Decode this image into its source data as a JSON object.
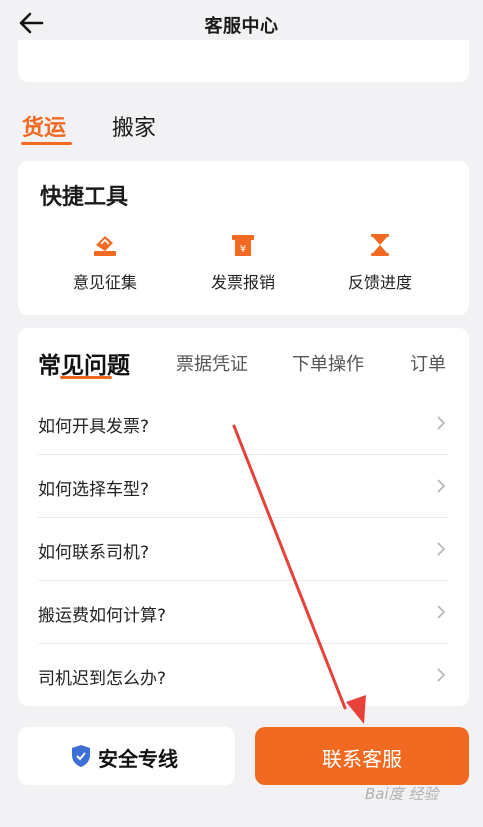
{
  "header": {
    "title": "客服中心"
  },
  "main_tabs": [
    {
      "label": "货运",
      "active": true
    },
    {
      "label": "搬家",
      "active": false
    }
  ],
  "tools": {
    "heading": "快捷工具",
    "items": [
      {
        "label": "意见征集",
        "icon": "feedback-collect-icon"
      },
      {
        "label": "发票报销",
        "icon": "invoice-icon"
      },
      {
        "label": "反馈进度",
        "icon": "hourglass-icon"
      }
    ]
  },
  "faq": {
    "tabs": [
      {
        "label": "常见问题",
        "active": true
      },
      {
        "label": "票据凭证",
        "active": false
      },
      {
        "label": "下单操作",
        "active": false
      },
      {
        "label": "订单",
        "active": false
      }
    ],
    "items": [
      {
        "text": "如何开具发票?"
      },
      {
        "text": "如何选择车型?"
      },
      {
        "text": "如何联系司机?"
      },
      {
        "text": "搬运费如何计算?"
      },
      {
        "text": "司机迟到怎么办?"
      }
    ]
  },
  "footer": {
    "safety_label": "安全专线",
    "contact_label": "联系客服"
  },
  "watermark": "Bai度 经验",
  "colors": {
    "accent": "#f26a21",
    "shield": "#3d6fd6",
    "annotation_arrow": "#e8403a"
  }
}
